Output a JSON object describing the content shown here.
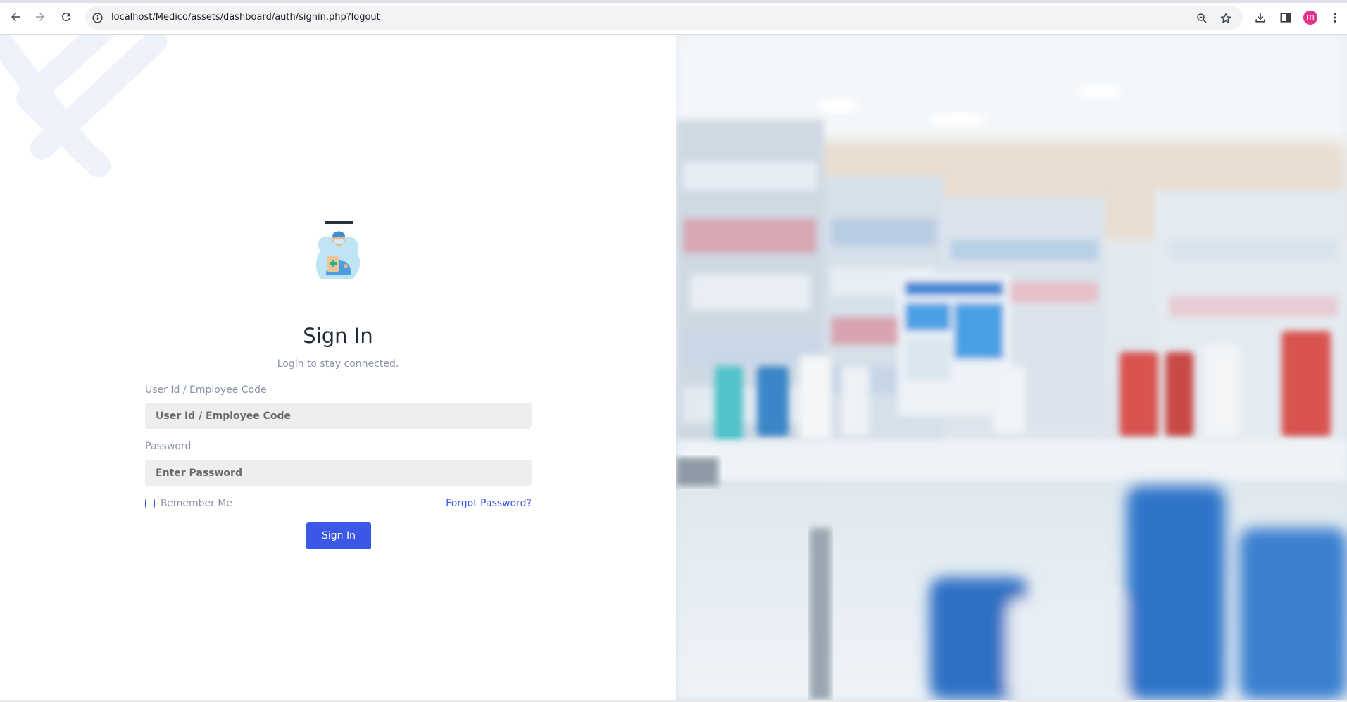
{
  "browser": {
    "url": "localhost/Medico/assets/dashboard/auth/signin.php?logout",
    "profile_initial": "m",
    "profile_color": "#e2328b"
  },
  "signin": {
    "title": "Sign In",
    "subtitle": "Login to stay connected.",
    "user_label": "User Id / Employee Code",
    "user_placeholder": "User Id / Employee Code",
    "password_label": "Password",
    "password_placeholder": "Enter Password",
    "remember_label": "Remember Me",
    "forgot_label": "Forgot Password?",
    "button_label": "Sign In",
    "accent_color": "#3a57e8"
  },
  "icons": {
    "back": "arrow-left-icon",
    "forward": "arrow-right-icon",
    "reload": "reload-icon",
    "site_info": "info-icon",
    "zoom": "zoom-icon",
    "bookmark": "star-icon",
    "download": "download-icon",
    "side_panel": "side-panel-icon",
    "menu": "kebab-menu-icon"
  }
}
